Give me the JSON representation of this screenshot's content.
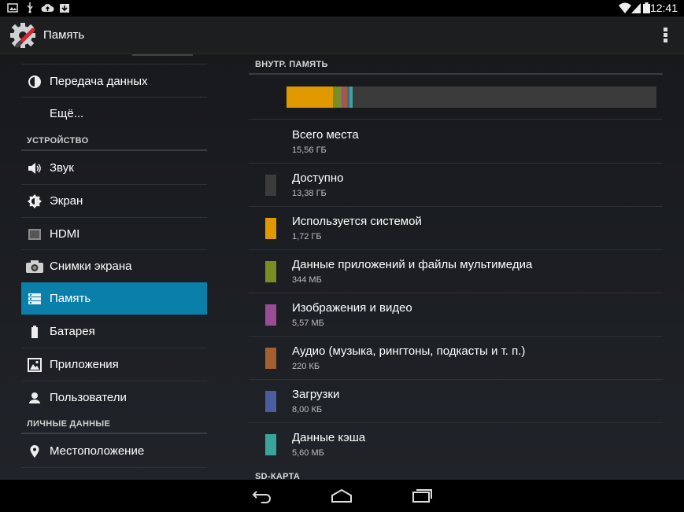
{
  "status_bar": {
    "time": "12:41",
    "left_icons": [
      "gallery-icon",
      "usb-icon",
      "cloud-upload-icon",
      "download-icon"
    ],
    "right_icons": [
      "wifi-icon",
      "signal-icon",
      "battery-icon"
    ]
  },
  "action_bar": {
    "title": "Память",
    "icon": "settings-icon",
    "overflow_icon": "overflow-menu-icon"
  },
  "sidebar": {
    "items_top": [
      {
        "label": "Передача данных",
        "icon": "data-usage-icon"
      },
      {
        "label": "Ещё...",
        "icon": ""
      }
    ],
    "section_device": "УСТРОЙСТВО",
    "items_device": [
      {
        "label": "Звук",
        "icon": "volume-icon"
      },
      {
        "label": "Экран",
        "icon": "brightness-icon"
      },
      {
        "label": "HDMI",
        "icon": "hdmi-icon"
      },
      {
        "label": "Снимки экрана",
        "icon": "camera-icon"
      },
      {
        "label": "Память",
        "icon": "storage-icon",
        "active": true
      },
      {
        "label": "Батарея",
        "icon": "battery-icon"
      },
      {
        "label": "Приложения",
        "icon": "apps-icon"
      },
      {
        "label": "Пользователи",
        "icon": "user-icon"
      }
    ],
    "section_personal": "ЛИЧНЫЕ ДАННЫЕ",
    "items_personal": [
      {
        "label": "Местоположение",
        "icon": "location-icon"
      }
    ]
  },
  "storage": {
    "internal_header": "ВНУТР. ПАМЯТЬ",
    "sd_header": "SD-КАРТА",
    "usage_segments": [
      {
        "color": "#e09a00",
        "fraction": 0.126
      },
      {
        "color": "#7a8c24",
        "fraction": 0.022
      },
      {
        "color": "#9a4d96",
        "fraction": 0.008
      },
      {
        "color": "#a35f30",
        "fraction": 0.008
      },
      {
        "color": "#4a5e9e",
        "fraction": 0.006
      },
      {
        "color": "#3aa39a",
        "fraction": 0.008
      }
    ],
    "usage_remaining_color": "#3b3b3b",
    "rows": [
      {
        "title": "Всего места",
        "value": "15,56 ГБ",
        "color": ""
      },
      {
        "title": "Доступно",
        "value": "13,38 ГБ",
        "color": "#3b3b3b"
      },
      {
        "title": "Используется системой",
        "value": "1,72 ГБ",
        "color": "#e09a00"
      },
      {
        "title": "Данные приложений и файлы мультимедиа",
        "value": "344 МБ",
        "color": "#7a8c24"
      },
      {
        "title": "Изображения и видео",
        "value": "5,57 МБ",
        "color": "#9a4d96"
      },
      {
        "title": "Аудио (музыка, рингтоны, подкасты и т. п.)",
        "value": "220 КБ",
        "color": "#a35f30"
      },
      {
        "title": "Загрузки",
        "value": "8,00 КБ",
        "color": "#4a5e9e"
      },
      {
        "title": "Данные кэша",
        "value": "5,60 МБ",
        "color": "#3aa39a"
      }
    ]
  },
  "nav_bar": {
    "buttons": [
      "back-icon",
      "home-icon",
      "recents-icon"
    ]
  }
}
